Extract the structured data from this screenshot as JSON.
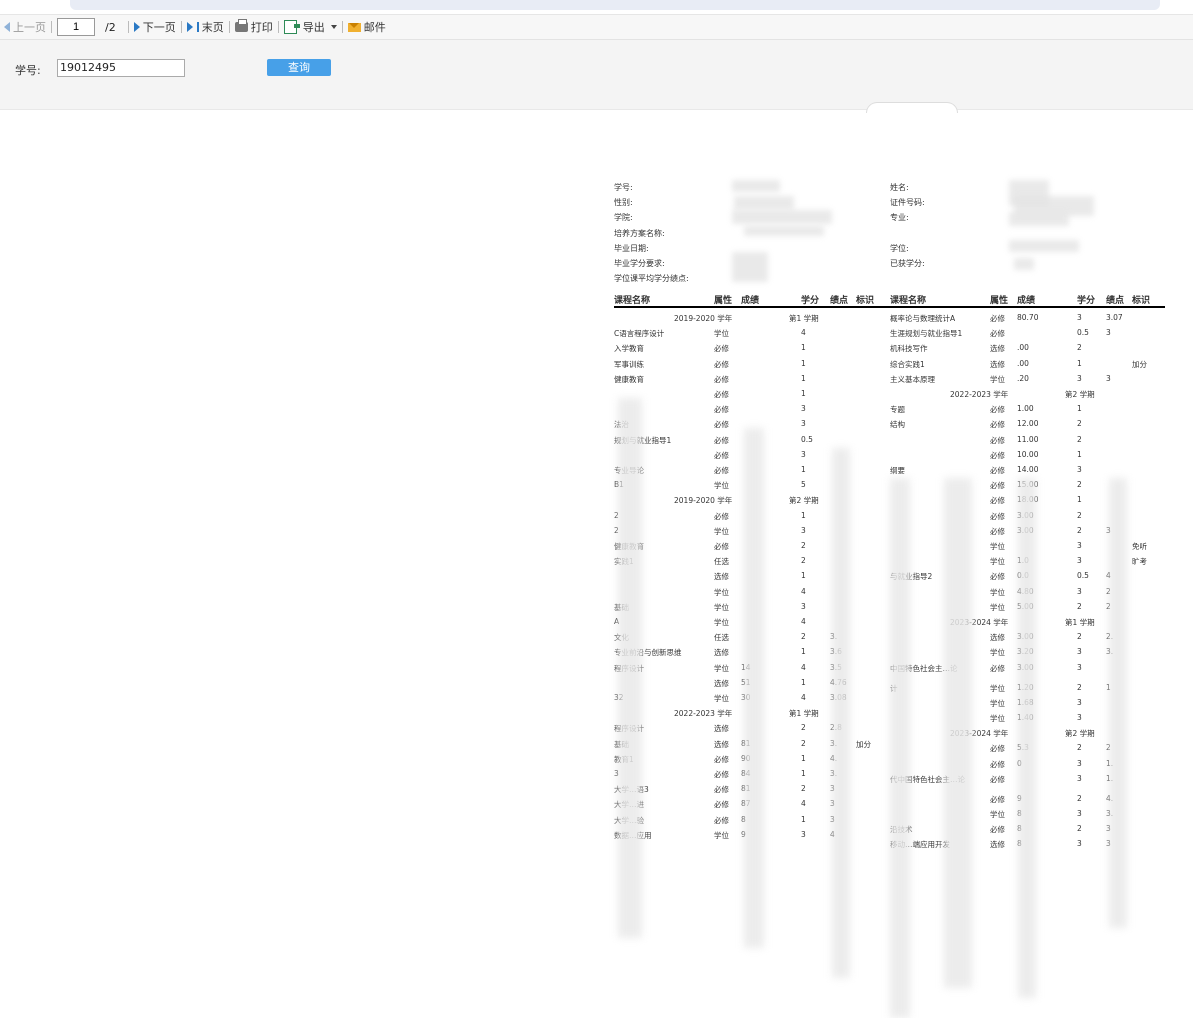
{
  "toolbar": {
    "prev": "上一页",
    "page_value": "1",
    "page_total": "/2",
    "next": "下一页",
    "last": "末页",
    "print": "打印",
    "export": "导出",
    "mail": "邮件"
  },
  "query": {
    "label": "学号:",
    "value": "19012495",
    "button": "查询"
  },
  "report": {
    "info_left": [
      "学号:",
      "性别:",
      "学院:",
      "培养方案名称:",
      "毕业日期:",
      "毕业学分要求:",
      "学位课平均学分绩点:"
    ],
    "info_right": [
      "姓名:",
      "证件号码:",
      "专业:",
      "",
      "学位:",
      "已获学分:",
      ""
    ],
    "columns": [
      "课程名称",
      "属性",
      "成绩",
      "学分",
      "绩点",
      "标识"
    ],
    "left_rows": [
      {
        "t": "term",
        "year": "2019-2020 学年",
        "term": "第1 学期"
      },
      {
        "t": "c",
        "name": "C语言程序设计",
        "attr": "学位",
        "credit": "4"
      },
      {
        "t": "c",
        "name": "入学教育",
        "attr": "必修",
        "credit": "1"
      },
      {
        "t": "c",
        "name": "军事训练",
        "attr": "必修",
        "credit": "1"
      },
      {
        "t": "c",
        "name": "健康教育",
        "attr": "必修",
        "credit": "1"
      },
      {
        "t": "c",
        "name": "",
        "attr": "必修",
        "credit": "1"
      },
      {
        "t": "c",
        "name": "",
        "attr": "必修",
        "credit": "3"
      },
      {
        "t": "c",
        "name": "法治",
        "attr": "必修",
        "credit": "3"
      },
      {
        "t": "c",
        "name": "规划与就业指导1",
        "attr": "必修",
        "credit": "0.5"
      },
      {
        "t": "c",
        "name": "",
        "attr": "必修",
        "credit": "3"
      },
      {
        "t": "c",
        "name": "专业导论",
        "attr": "必修",
        "credit": "1"
      },
      {
        "t": "c",
        "name": "B1",
        "attr": "学位",
        "credit": "5"
      },
      {
        "t": "term",
        "year": "2019-2020 学年",
        "term": "第2 学期"
      },
      {
        "t": "c",
        "name": "2",
        "attr": "必修",
        "credit": "1"
      },
      {
        "t": "c",
        "name": "2",
        "attr": "学位",
        "credit": "3"
      },
      {
        "t": "c",
        "name": "健康教育",
        "attr": "必修",
        "credit": "2"
      },
      {
        "t": "c",
        "name": "实践1",
        "attr": "任选",
        "credit": "2"
      },
      {
        "t": "c",
        "name": "",
        "attr": "选修",
        "credit": "1"
      },
      {
        "t": "c",
        "name": "",
        "attr": "学位",
        "credit": "4"
      },
      {
        "t": "c",
        "name": "基础",
        "attr": "学位",
        "credit": "3"
      },
      {
        "t": "c",
        "name": "A",
        "attr": "学位",
        "credit": "4"
      },
      {
        "t": "c",
        "name": "文化",
        "attr": "任选",
        "credit": "2",
        "gpa": "3."
      },
      {
        "t": "c",
        "name": "专业前沿与创新思维",
        "attr": "选修",
        "credit": "1",
        "gpa": "3.6"
      },
      {
        "t": "c",
        "name": "程序设计",
        "attr": "学位",
        "score": "14",
        "credit": "4",
        "gpa": "3.5"
      },
      {
        "t": "c",
        "name": "",
        "attr": "选修",
        "score": "51",
        "credit": "1",
        "gpa": "4.76"
      },
      {
        "t": "c",
        "name": "32",
        "attr": "学位",
        "score": "30",
        "credit": "4",
        "gpa": "3.08"
      },
      {
        "t": "term",
        "year": "2022-2023 学年",
        "term": "第1 学期"
      },
      {
        "t": "c",
        "name": "程序设计",
        "attr": "选修",
        "credit": "2",
        "gpa": "2.8"
      },
      {
        "t": "c",
        "name": "基础",
        "attr": "选修",
        "score": "81",
        "credit": "2",
        "gpa": "3.",
        "flag": "加分"
      },
      {
        "t": "c",
        "name": "教育1",
        "attr": "必修",
        "score": "90",
        "credit": "1",
        "gpa": "4."
      },
      {
        "t": "c",
        "name": "3",
        "attr": "必修",
        "score": "84",
        "credit": "1",
        "gpa": "3."
      },
      {
        "t": "c",
        "name": "大学…语3",
        "attr": "必修",
        "score": "81",
        "credit": "2",
        "gpa": "3"
      },
      {
        "t": "c",
        "name": "大学…进",
        "attr": "必修",
        "score": "87",
        "credit": "4",
        "gpa": "3"
      },
      {
        "t": "c",
        "name": "大学…验",
        "attr": "必修",
        "score": "8",
        "credit": "1",
        "gpa": "3"
      },
      {
        "t": "c",
        "name": "数据…应用",
        "attr": "学位",
        "score": "9",
        "credit": "3",
        "gpa": "4"
      }
    ],
    "right_rows": [
      {
        "t": "c",
        "name": "概率论与数理统计A",
        "attr": "必修",
        "score": "80.70",
        "credit": "3",
        "gpa": "3.07"
      },
      {
        "t": "c",
        "name": "生涯规划与就业指导1",
        "attr": "必修",
        "credit": "0.5",
        "gpa": "3"
      },
      {
        "t": "c",
        "name": "机科技写作",
        "attr": "选修",
        "score": ".00",
        "credit": "2"
      },
      {
        "t": "c",
        "name": "综合实践1",
        "attr": "选修",
        "score": ".00",
        "credit": "1",
        "flag": "加分"
      },
      {
        "t": "c",
        "name": "主义基本原理",
        "attr": "学位",
        "score": ".20",
        "credit": "3",
        "gpa": "3"
      },
      {
        "t": "term",
        "year": "2022-2023 学年",
        "term": "第2 学期"
      },
      {
        "t": "c",
        "name": "专题",
        "attr": "必修",
        "score": "1.00",
        "credit": "1"
      },
      {
        "t": "c",
        "name": "结构",
        "attr": "必修",
        "score": "12.00",
        "credit": "2"
      },
      {
        "t": "c",
        "name": "",
        "attr": "必修",
        "score": "11.00",
        "credit": "2"
      },
      {
        "t": "c",
        "name": "",
        "attr": "必修",
        "score": "10.00",
        "credit": "1"
      },
      {
        "t": "c",
        "name": "纲要",
        "attr": "必修",
        "score": "14.00",
        "credit": "3"
      },
      {
        "t": "c",
        "name": "",
        "attr": "必修",
        "score": "15.00",
        "credit": "2"
      },
      {
        "t": "c",
        "name": "",
        "attr": "必修",
        "score": "18.00",
        "credit": "1"
      },
      {
        "t": "c",
        "name": "",
        "attr": "必修",
        "score": "3.00",
        "credit": "2"
      },
      {
        "t": "c",
        "name": "",
        "attr": "必修",
        "score": "3.00",
        "credit": "2",
        "gpa": "3"
      },
      {
        "t": "c",
        "name": "",
        "attr": "学位",
        "credit": "3",
        "flag": "免听"
      },
      {
        "t": "c",
        "name": "",
        "attr": "学位",
        "score": "1.0",
        "credit": "3",
        "flag": "旷考"
      },
      {
        "t": "c",
        "name": "与就业指导2",
        "attr": "必修",
        "score": "0.0",
        "credit": "0.5",
        "gpa": "4"
      },
      {
        "t": "c",
        "name": "",
        "attr": "学位",
        "score": "4.80",
        "credit": "3",
        "gpa": "2"
      },
      {
        "t": "c",
        "name": "",
        "attr": "学位",
        "score": "5.00",
        "credit": "2",
        "gpa": "2"
      },
      {
        "t": "term",
        "year": "2023-2024 学年",
        "term": "第1 学期"
      },
      {
        "t": "c",
        "name": "",
        "attr": "选修",
        "score": "3.00",
        "credit": "2",
        "gpa": "2."
      },
      {
        "t": "c",
        "name": "",
        "attr": "学位",
        "score": "3.20",
        "credit": "3",
        "gpa": "3."
      },
      {
        "t": "c",
        "name": "中国特色社会主…论",
        "attr": "必修",
        "score": "3.00",
        "credit": "3"
      },
      {
        "t": "c",
        "name": "计",
        "attr": "学位",
        "score": "1.20",
        "credit": "2",
        "gpa": "1"
      },
      {
        "t": "c",
        "name": "",
        "attr": "学位",
        "score": "1.68",
        "credit": "3"
      },
      {
        "t": "c",
        "name": "",
        "attr": "学位",
        "score": "1.40",
        "credit": "3"
      },
      {
        "t": "term",
        "year": "2023-2024 学年",
        "term": "第2 学期"
      },
      {
        "t": "c",
        "name": "",
        "attr": "必修",
        "score": "5.3",
        "credit": "2",
        "gpa": "2"
      },
      {
        "t": "c",
        "name": "",
        "attr": "必修",
        "score": "0",
        "credit": "3",
        "gpa": "1."
      },
      {
        "t": "c",
        "name": "代中国特色社会主…论",
        "attr": "必修",
        "credit": "3",
        "gpa": "1."
      },
      {
        "t": "c",
        "name": "",
        "attr": "必修",
        "score": "9",
        "credit": "2",
        "gpa": "4."
      },
      {
        "t": "c",
        "name": "",
        "attr": "学位",
        "score": "8",
        "credit": "3",
        "gpa": "3."
      },
      {
        "t": "c",
        "name": "沿技术",
        "attr": "必修",
        "score": "8",
        "credit": "2",
        "gpa": "3"
      },
      {
        "t": "c",
        "name": "移动…端应用开发",
        "attr": "选修",
        "score": "8",
        "credit": "3",
        "gpa": "3"
      }
    ]
  }
}
